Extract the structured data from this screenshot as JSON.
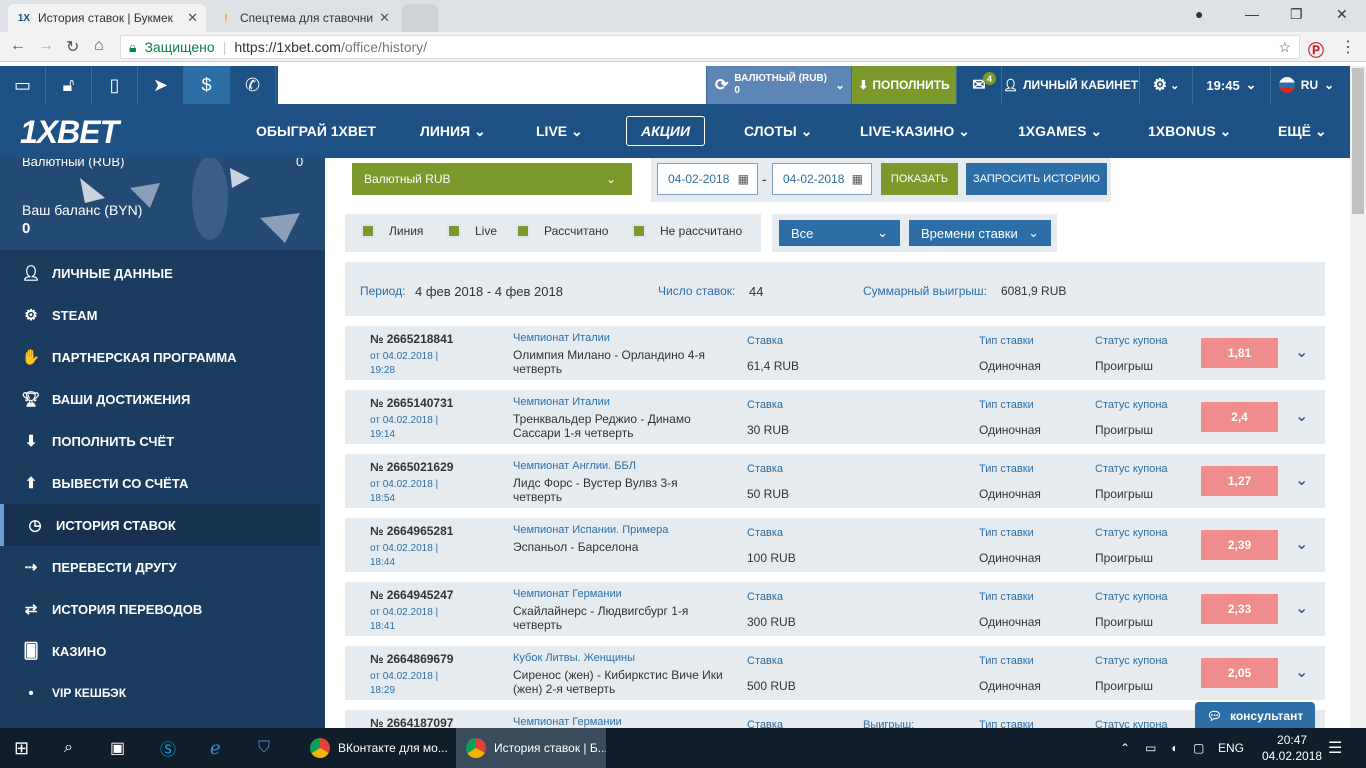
{
  "browser": {
    "tabs": [
      {
        "title": "История ставок | Букмек",
        "favicon": "1X"
      },
      {
        "title": "Спецтема для ставочни",
        "favicon": "!"
      }
    ],
    "secure_label": "Защищено",
    "url_host": "https://1xbet.com",
    "url_path": "/office/history/"
  },
  "topbar": {
    "currency_label": "ВАЛЮТНЫЙ (RUB)",
    "currency_value": "0",
    "deposit_button": "ПОПОЛНИТЬ",
    "mail_badge": "4",
    "cabinet_button": "ЛИЧНЫЙ КАБИНЕТ",
    "time": "19:45",
    "lang": "RU"
  },
  "nav": {
    "logo": "1XBET",
    "items": [
      "ОБЫГРАЙ 1XBET",
      "ЛИНИЯ",
      "LIVE",
      "АКЦИИ",
      "СЛОТЫ",
      "LIVE-КАЗИНО",
      "1XGAMES",
      "1XBONUS",
      "ЕЩЁ"
    ]
  },
  "sidebar": {
    "account_label": "Валютный (RUB)",
    "account_value": "0",
    "balance_label": "Ваш баланс (BYN)",
    "balance_value": "0",
    "menu": [
      {
        "label": "ЛИЧНЫЕ ДАННЫЕ",
        "icon": "user-plus-icon"
      },
      {
        "label": "STEAM",
        "icon": "steam-icon"
      },
      {
        "label": "ПАРТНЕРСКАЯ ПРОГРАММА",
        "icon": "handshake-icon"
      },
      {
        "label": "ВАШИ ДОСТИЖЕНИЯ",
        "icon": "trophy-icon"
      },
      {
        "label": "ПОПОЛНИТЬ СЧЁТ",
        "icon": "download-icon"
      },
      {
        "label": "ВЫВЕСТИ СО СЧЁТА",
        "icon": "upload-icon"
      },
      {
        "label": "ИСТОРИЯ СТАВОК",
        "icon": "clock-icon"
      },
      {
        "label": "ПЕРЕВЕСТИ ДРУГУ",
        "icon": "transfer-icon"
      },
      {
        "label": "ИСТОРИЯ ПЕРЕВОДОВ",
        "icon": "arrows-icon"
      },
      {
        "label": "КАЗИНО",
        "icon": "cards-icon"
      },
      {
        "label": "VIP КЕШБЭК",
        "icon": "bullet-icon"
      }
    ]
  },
  "filters": {
    "account_select": "Валютный RUB",
    "date_from": "04-02-2018",
    "date_to": "04-02-2018",
    "date_sep": "-",
    "show_button": "ПОКАЗАТЬ",
    "request_button": "ЗАПРОСИТЬ ИСТОРИЮ",
    "checkboxes": [
      "Линия",
      "Live",
      "Рассчитано",
      "Не рассчитано"
    ],
    "type_select": "Все",
    "sort_select": "Времени ставки"
  },
  "summary": {
    "period_label": "Период:",
    "period_value": "4 фев 2018 - 4 фев 2018",
    "count_label": "Число ставок:",
    "count_value": "44",
    "win_label": "Суммарный выигрыш:",
    "win_value": "6081,9 RUB"
  },
  "labels": {
    "stake": "Ставка",
    "bet_type": "Тип ставки",
    "coupon_status": "Статус купона",
    "win": "Выигрыш:"
  },
  "bets": [
    {
      "number": "№ 2665218841",
      "date": "от 04.02.2018 | 19:28",
      "championship": "Чемпионат Италии",
      "event": "Олимпия Милано - Орландино 4-я четверть",
      "stake": "61,4 RUB",
      "type": "Одиночная",
      "status": "Проигрыш",
      "odds": "1,81"
    },
    {
      "number": "№ 2665140731",
      "date": "от 04.02.2018 | 19:14",
      "championship": "Чемпионат Италии",
      "event": "Тренквальдер Реджио - Динамо Сассари 1-я четверть",
      "stake": "30 RUB",
      "type": "Одиночная",
      "status": "Проигрыш",
      "odds": "2,4"
    },
    {
      "number": "№ 2665021629",
      "date": "от 04.02.2018 | 18:54",
      "championship": "Чемпионат Англии. ББЛ",
      "event": "Лидс Форс - Вустер Вулвз 3-я четверть",
      "stake": "50 RUB",
      "type": "Одиночная",
      "status": "Проигрыш",
      "odds": "1,27"
    },
    {
      "number": "№ 2664965281",
      "date": "от 04.02.2018 | 18:44",
      "championship": "Чемпионат Испании. Примера",
      "event": "Эспаньол - Барселона",
      "stake": "100 RUB",
      "type": "Одиночная",
      "status": "Проигрыш",
      "odds": "2,39"
    },
    {
      "number": "№ 2664945247",
      "date": "от 04.02.2018 | 18:41",
      "championship": "Чемпионат Германии",
      "event": "Скайлайнерс - Людвигсбург 1-я четверть",
      "stake": "300 RUB",
      "type": "Одиночная",
      "status": "Проигрыш",
      "odds": "2,33"
    },
    {
      "number": "№ 2664869679",
      "date": "от 04.02.2018 | 18:29",
      "championship": "Кубок Литвы. Женщины",
      "event": "Сиренос (жен) - Кибиркстис Виче Ики (жен) 2-я четверть",
      "stake": "500 RUB",
      "type": "Одиночная",
      "status": "Проигрыш",
      "odds": "2,05"
    },
    {
      "number": "№ 2664187097",
      "date": "",
      "championship": "Чемпионат Германии",
      "event": "",
      "stake": "",
      "type": "",
      "status": "",
      "odds": ""
    }
  ],
  "consultant": "консультант",
  "taskbar": {
    "apps": [
      "ВКонтакте для мо...",
      "История ставок | Б..."
    ],
    "lang": "ENG",
    "time": "20:47",
    "date": "04.02.2018"
  }
}
